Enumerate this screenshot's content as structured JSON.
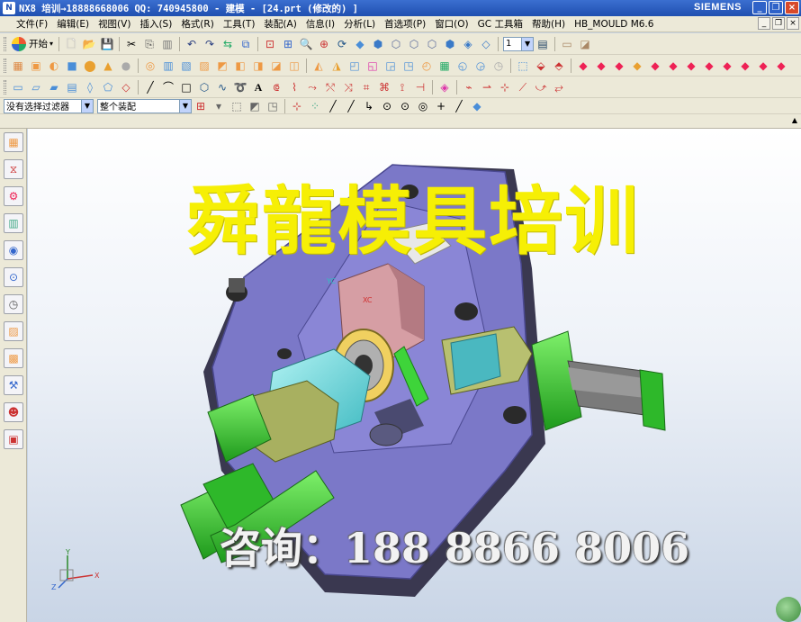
{
  "window": {
    "title": "NX8 培训→18888668006 QQ: 740945800 - 建模 - [24.prt (修改的) ]",
    "brand": "SIEMENS",
    "app_icon": "nx-icon"
  },
  "menu": {
    "items": [
      "文件(F)",
      "编辑(E)",
      "视图(V)",
      "插入(S)",
      "格式(R)",
      "工具(T)",
      "装配(A)",
      "信息(I)",
      "分析(L)",
      "首选项(P)",
      "窗口(O)",
      "GC 工具箱",
      "帮助(H)",
      "HB_MOULD M6.6"
    ]
  },
  "toolbar1": {
    "start_label": "开始",
    "layer_value": "1"
  },
  "selection_bar": {
    "filter_value": "没有选择过滤器",
    "scope_value": "整个装配"
  },
  "overlay": {
    "title": "舜龍模具培训",
    "contact": "咨询：188 8866 8006"
  },
  "triad": {
    "x_label": "X",
    "y_label": "Y",
    "z_label": "Z"
  },
  "model_labels": {
    "yc": "YC",
    "xc": "XC"
  },
  "colors": {
    "titlebar": "#1f4fb0",
    "base_plate": "#7b78c8",
    "slider_green": "#2ec62a",
    "overlay_title": "#f6ef05"
  }
}
